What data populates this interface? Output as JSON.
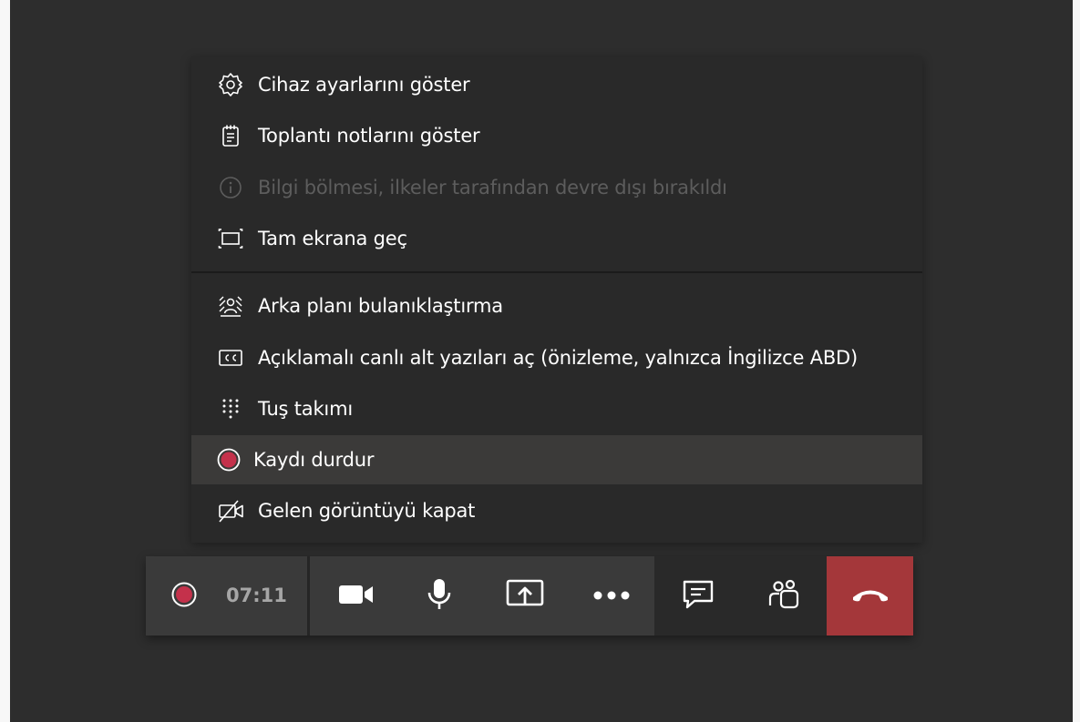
{
  "menu": {
    "items": [
      {
        "label": "Cihaz ayarlarını göster",
        "icon": "gear-icon",
        "enabled": true
      },
      {
        "label": "Toplantı notlarını göster",
        "icon": "notes-icon",
        "enabled": true
      },
      {
        "label": "Bilgi bölmesi, ilkeler tarafından devre dışı bırakıldı",
        "icon": "info-icon",
        "enabled": false
      },
      {
        "label": "Tam ekrana geç",
        "icon": "fullscreen-icon",
        "enabled": true
      },
      {
        "label": "Arka planı bulanıklaştırma",
        "icon": "blur-background-icon",
        "enabled": true
      },
      {
        "label": "Açıklamalı canlı alt yazıları aç (önizleme, yalnızca İngilizce ABD)",
        "icon": "closed-captions-icon",
        "enabled": true
      },
      {
        "label": "Tuş takımı",
        "icon": "dialpad-icon",
        "enabled": true
      },
      {
        "label": "Kaydı durdur",
        "icon": "record-icon",
        "enabled": true,
        "highlighted": true
      },
      {
        "label": "Gelen görüntüyü kapat",
        "icon": "video-off-icon",
        "enabled": true
      }
    ]
  },
  "callbar": {
    "timer": "07:11",
    "buttons": [
      {
        "name": "recording-indicator",
        "icon": "record-icon"
      },
      {
        "name": "camera",
        "icon": "camera-icon"
      },
      {
        "name": "microphone",
        "icon": "microphone-icon"
      },
      {
        "name": "share",
        "icon": "share-screen-icon"
      },
      {
        "name": "more",
        "icon": "more-options-icon"
      },
      {
        "name": "chat",
        "icon": "chat-icon"
      },
      {
        "name": "participants",
        "icon": "participants-icon"
      },
      {
        "name": "hang-up",
        "icon": "hang-up-icon"
      }
    ]
  },
  "colors": {
    "background": "#2d2d2d",
    "menu": "#292929",
    "menu_highlight": "#3b3a39",
    "record_red": "#c4314b",
    "hangup_red": "#a4373a",
    "disabled_text": "#5d5d5d"
  }
}
